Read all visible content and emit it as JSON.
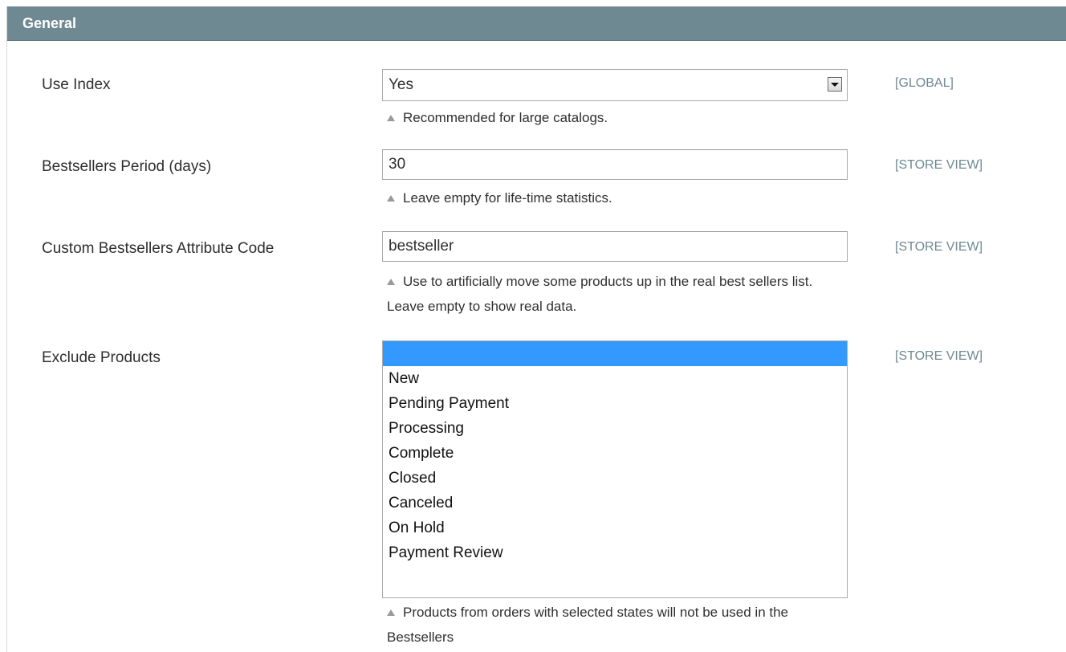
{
  "section": {
    "title": "General"
  },
  "fields": {
    "use_index": {
      "label": "Use Index",
      "value": "Yes",
      "note": "Recommended for large catalogs.",
      "scope": "[GLOBAL]"
    },
    "bestsellers_period": {
      "label": "Bestsellers Period (days)",
      "value": "30",
      "note": "Leave empty for life-time statistics.",
      "scope": "[STORE VIEW]"
    },
    "custom_attribute": {
      "label": "Custom Bestsellers Attribute Code",
      "value": "bestseller",
      "note": "Use to artificially move some products up in the real best sellers list. Leave empty to show real data.",
      "scope": "[STORE VIEW]"
    },
    "exclude_products": {
      "label": "Exclude Products",
      "options": [
        "",
        "New",
        "Pending Payment",
        "Processing",
        "Complete",
        "Closed",
        "Canceled",
        "On Hold",
        "Payment Review"
      ],
      "selected_index": 0,
      "note": "Products from orders with selected states will not be used in the Bestsellers",
      "scope": "[STORE VIEW]"
    }
  },
  "colors": {
    "header_bg": "#6f8992",
    "scope_text": "#6f8992",
    "selection": "#3399ff"
  },
  "icons": {
    "note": "triangle-up-icon",
    "dropdown": "chevron-down-icon"
  }
}
